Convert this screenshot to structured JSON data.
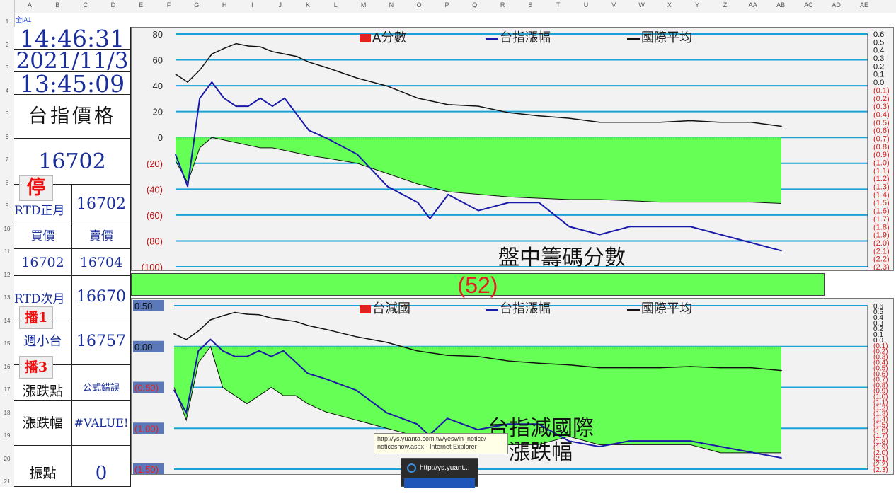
{
  "sheet": {
    "name_box": "全|A1",
    "columns": [
      "A",
      "B",
      "C",
      "D",
      "E",
      "F",
      "G",
      "H",
      "I",
      "J",
      "K",
      "L",
      "M",
      "N",
      "O",
      "P",
      "Q",
      "R",
      "S",
      "T",
      "U",
      "V",
      "W",
      "X",
      "Y",
      "Z",
      "AA",
      "AB",
      "AC",
      "AD",
      "AE"
    ],
    "rows": [
      "1",
      "2",
      "3",
      "4",
      "5",
      "6",
      "7",
      "8",
      "9",
      "10",
      "11",
      "12",
      "13",
      "14",
      "15",
      "16",
      "17",
      "18",
      "19",
      "20",
      "21"
    ]
  },
  "panel": {
    "time": "14:46:31",
    "date": "2021/11/3",
    "time2": "13:45:09",
    "price_label": "台指價格",
    "price_value": "16702",
    "stop_btn": "停",
    "rtd_front_label": "RTD正月",
    "rtd_front_value": "16702",
    "bid_label": "買價",
    "ask_label": "賣價",
    "bid_value": "16702",
    "ask_value": "16704",
    "rtd_next_label": "RTD次月",
    "rtd_next_value": "16670",
    "play1_btn": "播1",
    "weekly_label": "週小台",
    "weekly_value": "16757",
    "play3_btn": "播3",
    "change_pts_label": "漲跌點",
    "change_pts_value": "公式錯誤",
    "change_pct_label": "漲跌幅",
    "change_pct_value": "#VALUE!",
    "amplitude_label": "振點",
    "amplitude_value": "0"
  },
  "score_bar": {
    "value": "(52)"
  },
  "tooltip": {
    "line1": "http://ys.yuanta.com.tw/yeswin_notice/",
    "line2": "noticeshow.aspx - Internet Explorer"
  },
  "taskbar_thumb": {
    "title": "http://ys.yuant..."
  },
  "colors": {
    "green": "#66ff55",
    "blue": "#1a1aa8",
    "black": "#111111",
    "grid": "#1aa2d8",
    "red": "#e52020"
  },
  "chart_data": [
    {
      "type": "line",
      "title": "盤中籌碼分數",
      "legend": [
        "A分數",
        "台指漲幅",
        "國際平均"
      ],
      "legend_colors": [
        "#e52020",
        "#1a1aa8",
        "#111111"
      ],
      "y_left_ticks": [
        "80",
        "60",
        "40",
        "20",
        "0",
        "(20)",
        "(40)",
        "(60)",
        "(80)",
        "(100)"
      ],
      "y_right_ticks": [
        "0.6",
        "0.5",
        "0.4",
        "0.3",
        "0.2",
        "0.1",
        "0.0",
        "(0.1)",
        "(0.2)",
        "(0.3)",
        "(0.4)",
        "(0.5)",
        "(0.6)",
        "(0.7)",
        "(0.8)",
        "(0.9)",
        "(1.0)",
        "(1.1)",
        "(1.2)",
        "(1.3)",
        "(1.4)",
        "(1.5)",
        "(1.6)",
        "(1.7)",
        "(1.8)",
        "(1.9)",
        "(2.0)",
        "(2.1)",
        "(2.2)",
        "(2.3)"
      ],
      "ylim": [
        -100,
        80
      ],
      "y2lim": [
        -2.3,
        0.6
      ],
      "series": [
        {
          "name": "A分數",
          "x": [
            0,
            2,
            4,
            6,
            8,
            10,
            12,
            14,
            16,
            18,
            20,
            22,
            25,
            30,
            35,
            40,
            45,
            50,
            55,
            60,
            65,
            70,
            75,
            80,
            85,
            90,
            95,
            100
          ],
          "values": [
            -18,
            -35,
            -8,
            0,
            -2,
            -4,
            -6,
            -8,
            -8,
            -10,
            -12,
            -14,
            -16,
            -20,
            -28,
            -36,
            -42,
            -44,
            -46,
            -47,
            -48,
            -48,
            -49,
            -50,
            -50,
            -50,
            -50,
            -51
          ]
        },
        {
          "name": "台指漲幅",
          "x": [
            0,
            2,
            4,
            6,
            8,
            10,
            12,
            14,
            16,
            18,
            20,
            22,
            25,
            30,
            35,
            40,
            42,
            45,
            50,
            55,
            60,
            65,
            70,
            75,
            80,
            85,
            90,
            95,
            100
          ],
          "values": [
            -0.9,
            -1.3,
            -0.2,
            0.0,
            -0.2,
            -0.3,
            -0.3,
            -0.2,
            -0.3,
            -0.2,
            -0.4,
            -0.6,
            -0.7,
            -0.9,
            -1.3,
            -1.5,
            -1.7,
            -1.4,
            -1.6,
            -1.5,
            -1.5,
            -1.8,
            -1.9,
            -1.8,
            -1.8,
            -1.8,
            -1.9,
            -2.0,
            -2.1
          ]
        },
        {
          "name": "國際平均",
          "x": [
            0,
            2,
            4,
            6,
            8,
            10,
            12,
            14,
            16,
            18,
            20,
            22,
            25,
            30,
            35,
            40,
            45,
            50,
            55,
            60,
            65,
            70,
            75,
            80,
            85,
            90,
            95,
            100
          ],
          "values": [
            0.1,
            0.0,
            0.15,
            0.35,
            0.42,
            0.48,
            0.45,
            0.44,
            0.38,
            0.35,
            0.32,
            0.25,
            0.18,
            0.05,
            -0.05,
            -0.2,
            -0.28,
            -0.3,
            -0.38,
            -0.42,
            -0.45,
            -0.5,
            -0.5,
            -0.5,
            -0.48,
            -0.5,
            -0.5,
            -0.55
          ]
        }
      ]
    },
    {
      "type": "line",
      "title": "台指減國際 漲跌幅",
      "legend": [
        "台減國",
        "台指漲幅",
        "國際平均"
      ],
      "legend_colors": [
        "#e52020",
        "#1a1aa8",
        "#111111"
      ],
      "y_left_ticks": [
        "0.50",
        "0.00",
        "(0.50)",
        "(1.00)",
        "(1.50)"
      ],
      "y_right_ticks": [
        "0.6",
        "0.5",
        "0.4",
        "0.3",
        "0.2",
        "0.1",
        "0.0",
        "(0.1)",
        "(0.2)",
        "(0.3)",
        "(0.4)",
        "(0.5)",
        "(0.6)",
        "(0.7)",
        "(0.8)",
        "(0.9)",
        "(1.0)",
        "(1.1)",
        "(1.2)",
        "(1.3)",
        "(1.4)",
        "(1.5)",
        "(1.6)",
        "(1.7)",
        "(1.8)",
        "(1.9)",
        "(2.0)",
        "(2.1)",
        "(2.2)",
        "(2.3)"
      ],
      "ylim": [
        -1.5,
        0.5
      ],
      "y2lim": [
        -2.3,
        0.6
      ],
      "series": [
        {
          "name": "台減國",
          "x": [
            0,
            2,
            4,
            6,
            8,
            10,
            12,
            14,
            16,
            18,
            20,
            22,
            25,
            30,
            35,
            40,
            45,
            50,
            55,
            60,
            65,
            70,
            75,
            80,
            85,
            90,
            95,
            100
          ],
          "values": [
            -0.5,
            -0.9,
            -0.2,
            0.0,
            -0.5,
            -0.6,
            -0.7,
            -0.6,
            -0.5,
            -0.6,
            -0.6,
            -0.7,
            -0.8,
            -0.9,
            -1.0,
            -1.1,
            -1.2,
            -1.1,
            -1.2,
            -1.2,
            -1.1,
            -1.2,
            -1.2,
            -1.2,
            -1.2,
            -1.3,
            -1.3,
            -1.3
          ]
        },
        {
          "name": "台指漲幅",
          "x": [
            0,
            2,
            4,
            6,
            8,
            10,
            12,
            14,
            16,
            18,
            20,
            22,
            25,
            30,
            35,
            40,
            42,
            45,
            50,
            55,
            60,
            65,
            70,
            75,
            80,
            85,
            90,
            95,
            100
          ],
          "values": [
            -0.9,
            -1.3,
            -0.2,
            0.0,
            -0.2,
            -0.3,
            -0.3,
            -0.2,
            -0.3,
            -0.2,
            -0.4,
            -0.6,
            -0.7,
            -0.9,
            -1.3,
            -1.5,
            -1.7,
            -1.4,
            -1.6,
            -1.5,
            -1.5,
            -1.8,
            -1.9,
            -1.8,
            -1.8,
            -1.8,
            -1.9,
            -2.0,
            -2.1
          ]
        },
        {
          "name": "國際平均",
          "x": [
            0,
            2,
            4,
            6,
            8,
            10,
            12,
            14,
            16,
            18,
            20,
            22,
            25,
            30,
            35,
            40,
            45,
            50,
            55,
            60,
            65,
            70,
            75,
            80,
            85,
            90,
            95,
            100
          ],
          "values": [
            0.1,
            0.0,
            0.15,
            0.35,
            0.42,
            0.48,
            0.45,
            0.44,
            0.38,
            0.35,
            0.32,
            0.25,
            0.18,
            0.05,
            -0.05,
            -0.2,
            -0.28,
            -0.3,
            -0.38,
            -0.42,
            -0.45,
            -0.5,
            -0.5,
            -0.5,
            -0.48,
            -0.5,
            -0.5,
            -0.55
          ]
        }
      ]
    }
  ]
}
